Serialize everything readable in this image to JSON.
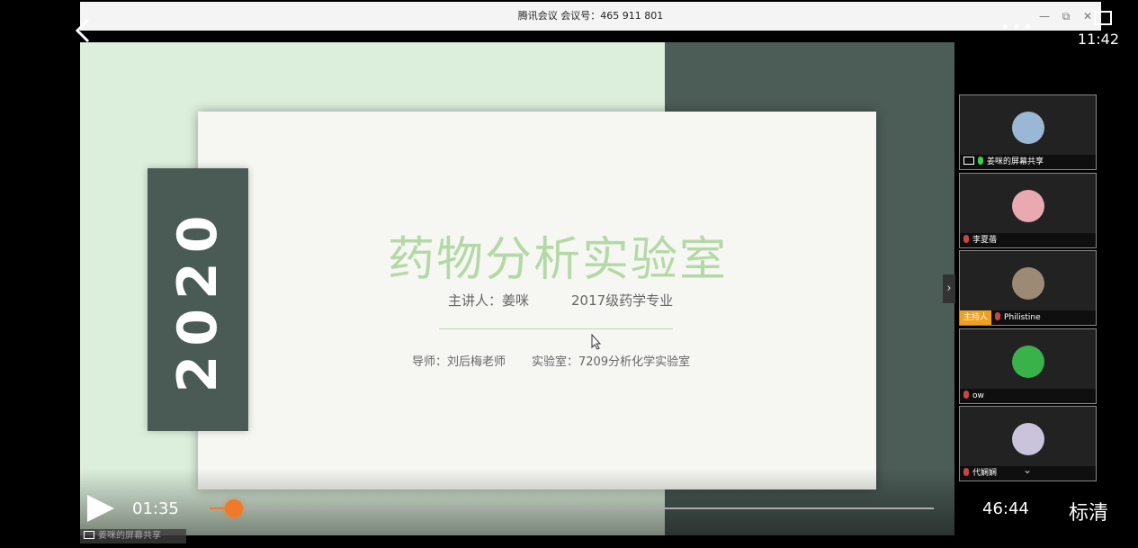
{
  "window": {
    "title": "腾讯会议  会议号：465 911 801",
    "minimize": "—",
    "restore": "⧉",
    "close": "✕"
  },
  "status": {
    "clock": "11:42",
    "more_icon": "•••"
  },
  "slide": {
    "year": "2020",
    "title": "药物分析实验室",
    "presenter": "主讲人：姜咪",
    "grade": "2017级药学专业",
    "advisor": "导师：刘后梅老师",
    "lab": "实验室：7209分析化学实验室",
    "colors": {
      "bg": "#dcefdc",
      "dark": "#4a5b55",
      "title": "#b4d9a6"
    }
  },
  "panel_toggle": "›",
  "participants": [
    {
      "name": "姜咪的屏幕共享",
      "screen_share": true,
      "mic_color": "#3ccf4e",
      "avatar_color": "#9ab8d6"
    },
    {
      "name": "李夏蓓",
      "mic_color": "#c94444",
      "avatar_color": "#e8a9b0"
    },
    {
      "name": "Philistine",
      "host_label": "主持人",
      "mic_color": "#c94444",
      "avatar_color": "#9c8a74"
    },
    {
      "name": "ow",
      "mic_color": "#c94444",
      "avatar_color": "#3ab24a"
    },
    {
      "name": "代娴娴",
      "mic_color": "#c94444",
      "avatar_color": "#c9c4dc",
      "expand": "⌄"
    }
  ],
  "player": {
    "current_time": "01:35",
    "total_time": "46:44",
    "quality": "标清",
    "progress": 0.0338,
    "accent": "#f07a2a"
  },
  "footer_share_label": "姜咪的屏幕共享"
}
